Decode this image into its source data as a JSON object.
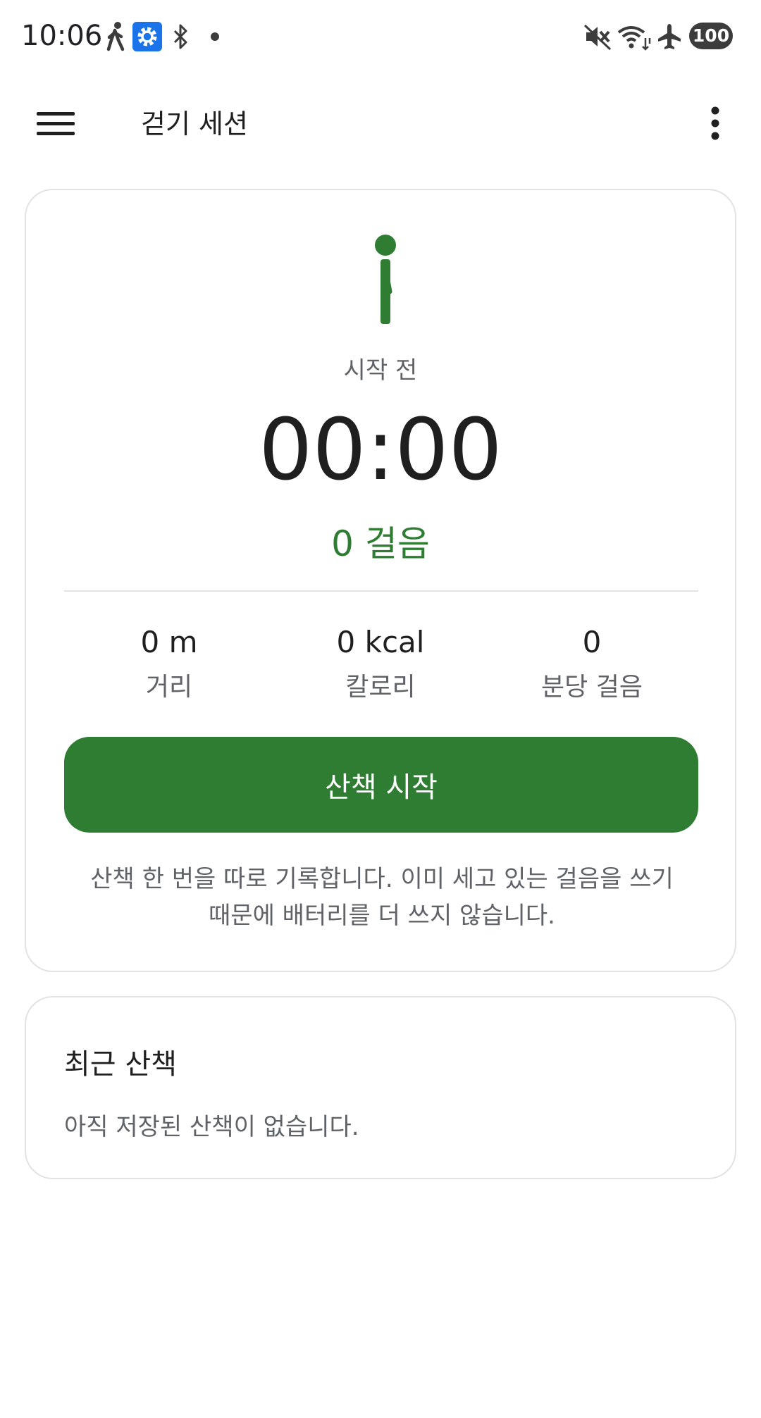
{
  "status_bar": {
    "time": "10:06",
    "battery": "100",
    "icons": [
      "walking-icon",
      "settings-icon",
      "bluetooth-icon",
      "dot-icon",
      "mute-icon",
      "wifi-icon",
      "airplane-icon"
    ]
  },
  "app_bar": {
    "title": "걷기 세션"
  },
  "session": {
    "state": "시작 전",
    "timer": "00:00",
    "steps": "0 걸음",
    "stats": [
      {
        "value": "0 m",
        "label": "거리"
      },
      {
        "value": "0 kcal",
        "label": "칼로리"
      },
      {
        "value": "0",
        "label": "분당 걸음"
      }
    ],
    "start_label": "산책 시작",
    "description_line1": "산책 한 번을 따로 기록합니다. 이미 세고 있는 걸음을 쓰기",
    "description_line2": "때문에 배터리를 더 쓰지 않습니다."
  },
  "recent": {
    "title": "최근 산책",
    "empty": "아직 저장된 산책이 없습니다."
  },
  "colors": {
    "accent": "#2e7d32",
    "text": "#1f1f1f",
    "secondary_text": "#5f6368",
    "card_border": "#e2e2e2"
  }
}
